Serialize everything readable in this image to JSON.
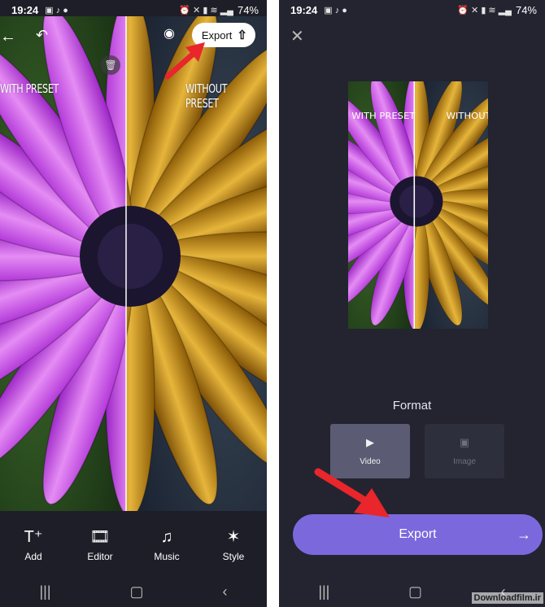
{
  "status": {
    "time": "19:24",
    "battery": "74%"
  },
  "editor": {
    "export_label": "Export",
    "label_left": "WITH PRESET",
    "label_right": "WITHOUT PRESET",
    "tools": [
      {
        "label": "Add",
        "icon": "add-text-icon"
      },
      {
        "label": "Editor",
        "icon": "film-icon"
      },
      {
        "label": "Music",
        "icon": "music-note-icon"
      },
      {
        "label": "Style",
        "icon": "sparkle-icon"
      }
    ]
  },
  "export_screen": {
    "format_title": "Format",
    "formats": [
      {
        "label": "Video",
        "selected": true
      },
      {
        "label": "Image",
        "selected": false
      }
    ],
    "export_label": "Export"
  },
  "watermark": "Downloadfilm.ir",
  "colors": {
    "accent": "#7b68dc",
    "arrow": "#e8262b"
  }
}
